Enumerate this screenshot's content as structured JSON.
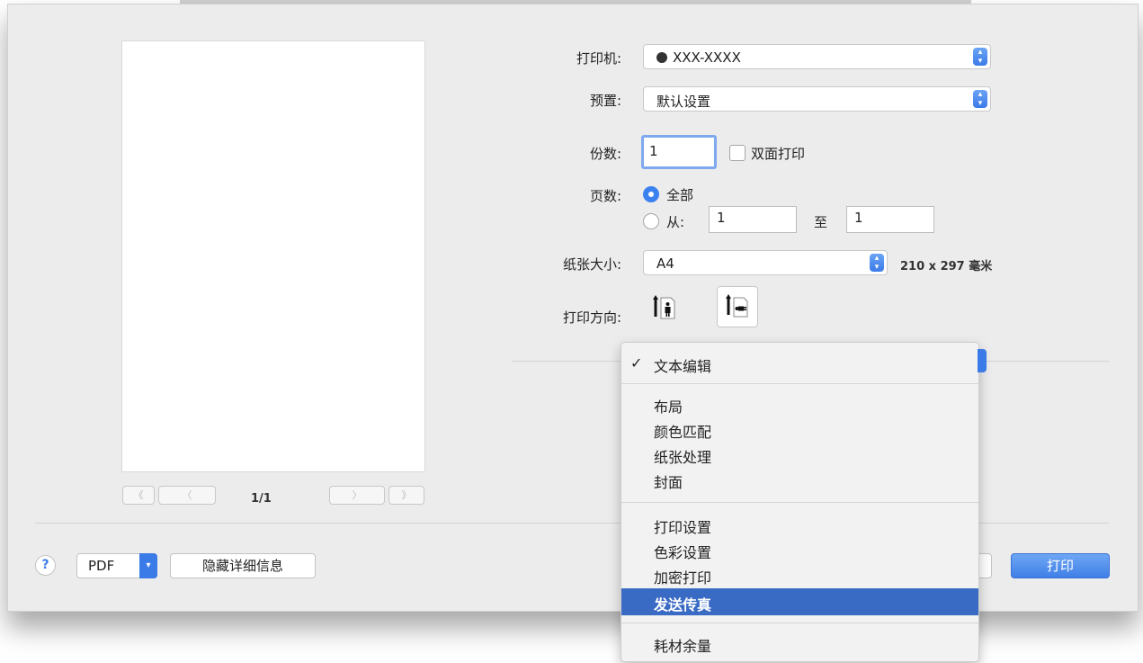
{
  "preview": {
    "page_counter": "1/1",
    "first_glyph": "《",
    "prev_glyph": "〈",
    "next_glyph": "〉",
    "last_glyph": "》"
  },
  "printer": {
    "label": "打印机:",
    "value": "XXX-XXXX"
  },
  "presets": {
    "label": "预置:",
    "value": "默认设置"
  },
  "copies": {
    "label": "份数:",
    "value": "1",
    "duplex_label": "双面打印"
  },
  "pages": {
    "label": "页数:",
    "all_label": "全部",
    "from_label": "从:",
    "from_value": "1",
    "to_label": "至",
    "to_value": "1"
  },
  "paper": {
    "label": "纸张大小:",
    "value": "A4",
    "dimensions": "210 x 297 毫米"
  },
  "orientation": {
    "label": "打印方向:"
  },
  "footer": {
    "help": "?",
    "pdf_label": "PDF",
    "hide_details": "隐藏详细信息",
    "print_label": "打印"
  },
  "panel_menu": {
    "checkmark": "✓",
    "selected": "文本编辑",
    "group1": [
      "布局",
      "颜色匹配",
      "纸张处理",
      "封面"
    ],
    "group2": [
      "打印设置",
      "色彩设置",
      "加密打印"
    ],
    "highlighted": "发送传真",
    "group3": [
      "耗材余量"
    ]
  },
  "colors": {
    "accent": "#3b7be8",
    "highlight": "#3a6bc4",
    "dialog_bg": "#ececec"
  }
}
